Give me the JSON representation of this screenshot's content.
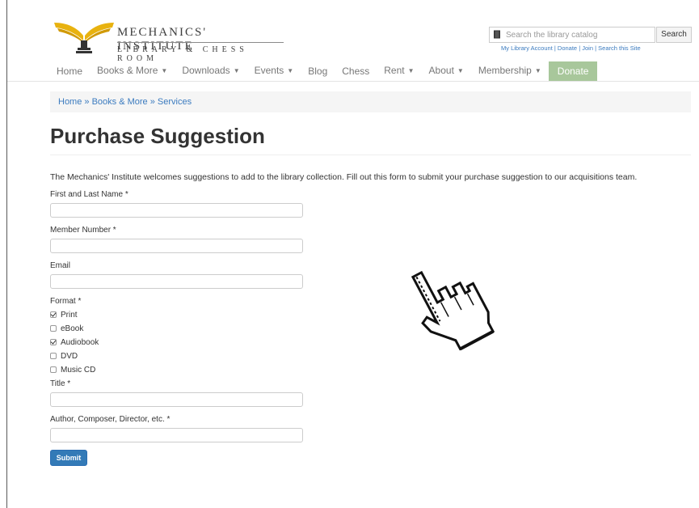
{
  "header": {
    "logo_title": "MECHANICS' INSTITUTE",
    "logo_subtitle": "LIBRARY & CHESS ROOM",
    "search": {
      "placeholder": "Search the library catalog",
      "button_label": "Search",
      "icon": "book-icon"
    },
    "util_links": [
      {
        "label": "My Library Account"
      },
      {
        "label": "Donate"
      },
      {
        "label": "Join"
      },
      {
        "label": "Search this Site"
      }
    ],
    "util_separator": "|"
  },
  "nav": {
    "items": [
      {
        "label": "Home",
        "dropdown": false
      },
      {
        "label": "Books & More",
        "dropdown": true
      },
      {
        "label": "Downloads",
        "dropdown": true
      },
      {
        "label": "Events",
        "dropdown": true
      },
      {
        "label": "Blog",
        "dropdown": false
      },
      {
        "label": "Chess",
        "dropdown": false
      },
      {
        "label": "Rent",
        "dropdown": true
      },
      {
        "label": "About",
        "dropdown": true
      },
      {
        "label": "Membership",
        "dropdown": true
      }
    ],
    "donate_label": "Donate",
    "caret_glyph": "▼"
  },
  "breadcrumb": {
    "items": [
      "Home",
      "Books & More",
      "Services"
    ],
    "separator": " » "
  },
  "page": {
    "title": "Purchase Suggestion",
    "intro": "The Mechanics' Institute welcomes suggestions to add to the library collection.  Fill out this form to submit your purchase suggestion to our acquisitions team."
  },
  "form": {
    "name_label": "First and Last Name *",
    "name_value": "",
    "member_label": "Member Number *",
    "member_value": "",
    "email_label": "Email",
    "email_value": "",
    "format_label": "Format *",
    "formats": [
      {
        "label": "Print",
        "checked": true
      },
      {
        "label": "eBook",
        "checked": false
      },
      {
        "label": "Audiobook",
        "checked": true
      },
      {
        "label": "DVD",
        "checked": false
      },
      {
        "label": "Music CD",
        "checked": false
      }
    ],
    "title_label": "Title *",
    "title_value": "",
    "author_label": "Author, Composer, Director, etc. *",
    "author_value": "",
    "submit_label": "Submit"
  },
  "colors": {
    "link": "#3b7bbf",
    "donate_bg": "#a8c79b",
    "submit_bg": "#337ab7",
    "logo_gold": "#e8b20f"
  },
  "cursor_icon": "hand-pointer-icon"
}
